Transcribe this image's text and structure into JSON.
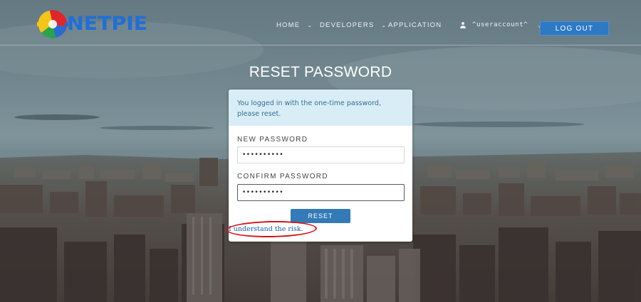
{
  "brand": {
    "name": "NETPIE",
    "text_color": "#1f6fd8",
    "logo_colors": [
      "#e0262a",
      "#f5c518",
      "#2d6ad0",
      "#2aa44a"
    ]
  },
  "nav": {
    "items": [
      {
        "label": "HOME",
        "caret": "⌄"
      },
      {
        "label": "DEVELOPERS",
        "caret": "⌄"
      },
      {
        "label": "APPLICATION",
        "caret": ""
      }
    ],
    "user": {
      "label": "^useraccount^",
      "caret": "⌄",
      "icon": "user-icon"
    },
    "logout_label": "LOG OUT",
    "logout_color": "#2e79c4"
  },
  "page": {
    "title": "RESET PASSWORD"
  },
  "form": {
    "alert_text": "You logged in with the one-time password, please reset.",
    "alert_bg": "#d9edf7",
    "new_password_label": "NEW PASSWORD",
    "new_password_value": "••••••••••",
    "confirm_password_label": "CONFIRM PASSWORD",
    "confirm_password_value": "••••••••••",
    "reset_label": "RESET",
    "reset_color": "#337ab7"
  },
  "annotation": {
    "risk_link_text": "I understand the risk.",
    "highlight_color": "#d41414"
  }
}
